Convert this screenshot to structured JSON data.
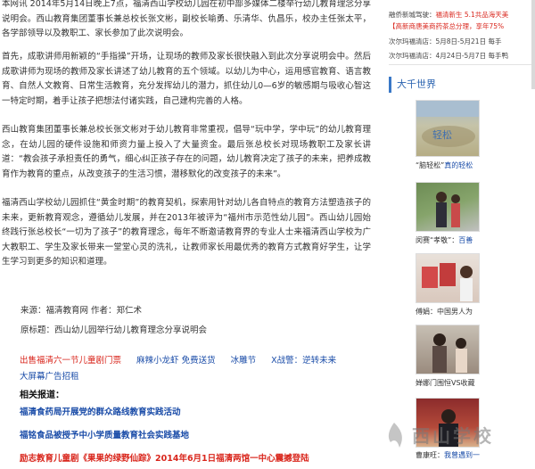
{
  "article": {
    "paragraphs": [
      "本网讯 2014年5月14日晚上7点，福清西山学校幼儿园在初中部多媒体二楼举行幼儿教育理念分享说明会。西山教育集团董事长兼总校长张文彬，副校长喻勇、乐清华、仇昌乐，校办主任张太平，各学部领导以及教职工、家长参加了此次说明会。",
      "首先，成歌讲师用新颖的“手指操”开场，让现场的教师及家长很快融入到此次分享说明会中。然后成歌讲师为现场的教师及家长讲述了幼儿教育的五个领域。以幼儿为中心，运用感官教育、语言教育、自然人文教育、日常生活教育，充分发挥幼儿的潜力，抓住幼儿0—6岁的敏感期与吸收心智这一特定时期，着手让孩子把想法付诸实践，自己建构完善的人格。",
      "西山教育集团董事长兼总校长张文彬对于幼儿教育非常重视，倡导“玩中学，学中玩”的幼儿教育理念，在幼儿园的硬件设施和师资力量上投入了大量资金。最后张总校长对现场教职工及家长讲道：“教会孩子承担责任的勇气，细心纠正孩子存在的问题，幼儿教育决定了孩子的未来，把养成教育作为教育的重点，从改变孩子的生活习惯，潜移默化的改变孩子的未来”。",
      "福清西山学校幼儿园抓住“黄金时期”的教育契机，探索用针对幼儿各自特点的教育方法塑造孩子的未来，更新教育观念，遵循幼儿发展，并在2013年被评为“福州市示范性幼儿园”。西山幼儿园始终践行张总校长“一切为了孩子”的教育理念，每年不断邀请教育界的专业人士来福清西山学校为广大教职工、学生及家长带来一堂堂心灵的洗礼，让教师家长用最优秀的教育方式教育好学生，让学生学习到更多的知识和道理。"
    ],
    "source": "来源：福清教育网 作者：郑仁术",
    "original_title": "原标题：西山幼儿园举行幼儿教育理念分享说明会"
  },
  "promos": [
    {
      "label": "出售福清六一节儿童剧门票",
      "color": "red"
    },
    {
      "label": "麻辣小龙虾 免费送货",
      "color": "blue"
    },
    {
      "label": "冰雕节",
      "color": "blue"
    },
    {
      "label": "X战警：逆转未来",
      "color": "blue"
    },
    {
      "label": "大屏幕广告招租",
      "color": "blue"
    }
  ],
  "related": {
    "title": "相关报道：",
    "items": [
      "福清食药局开展党的群众路线教育实践活动",
      "福铭食品被授予中小学质量教育社会实践基地",
      "励志教育儿童剧《果果的绿野仙踪》2014年6月1日福清两馆一中心震撼登陆"
    ]
  },
  "sidebar": {
    "notices": [
      {
        "prefix": "融侨新城驾驶：",
        "highlight": "福清新生 5.1共品海天美"
      },
      {
        "prefix": "",
        "highlight": "【高新商唐美商药茶总分理，享年75%"
      },
      {
        "prefix": "次尔玛福清店：5月8日-5月21日 每手",
        "highlight": ""
      },
      {
        "prefix": "次尔玛福清店：4月24日-5月7日 每手鸭",
        "highlight": ""
      }
    ],
    "section_title": "大千世界",
    "items": [
      {
        "caption_pre": "“脑轻松”",
        "caption_link": "真的轻松",
        "icon": "photo-crowd"
      },
      {
        "caption_pre": "闵赛“孝敬”：",
        "caption_link": "百善",
        "icon": "photo-couple"
      },
      {
        "caption_pre": "傅娟：中国男人为",
        "caption_link": "",
        "icon": "photo-book-woman"
      },
      {
        "caption_pre": "婵娜门围恒VS收藏",
        "caption_link": "",
        "icon": "photo-woman"
      },
      {
        "caption_pre": "曹康旺：",
        "caption_link": "我曾遇到一",
        "icon": "photo-man"
      }
    ]
  },
  "watermark": "西山学校",
  "colors": {
    "accent": "#2a63b0",
    "link_red": "#d9261c",
    "link_blue": "#1a4ca8"
  }
}
